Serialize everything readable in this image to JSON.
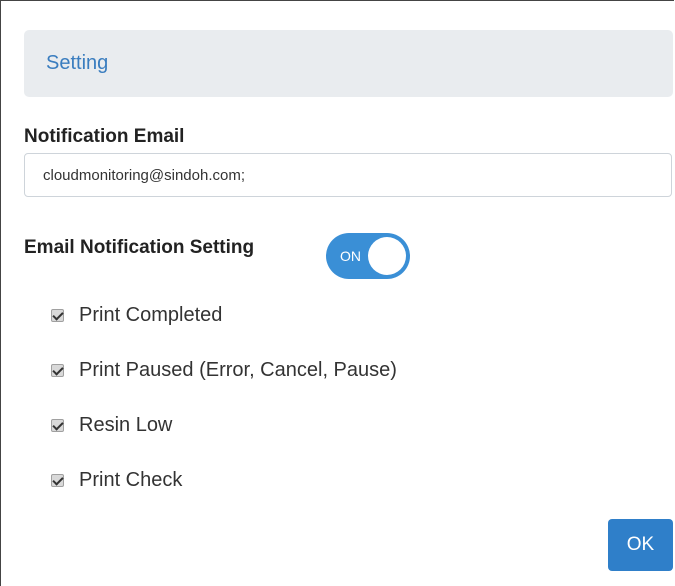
{
  "header": {
    "title": "Setting"
  },
  "notification_email": {
    "label": "Notification Email",
    "value": "cloudmonitoring@sindoh.com;"
  },
  "email_notification": {
    "label": "Email Notification Setting",
    "toggle_text": "ON",
    "toggle_state": "on",
    "toggle_color": "#3a8fd6"
  },
  "options": [
    {
      "label": "Print Completed",
      "checked": true
    },
    {
      "label": "Print Paused (Error, Cancel, Pause)",
      "checked": true
    },
    {
      "label": "Resin Low",
      "checked": true
    },
    {
      "label": "Print Check",
      "checked": true
    }
  ],
  "ok_button": {
    "label": "OK",
    "color": "#2f7fc9"
  }
}
